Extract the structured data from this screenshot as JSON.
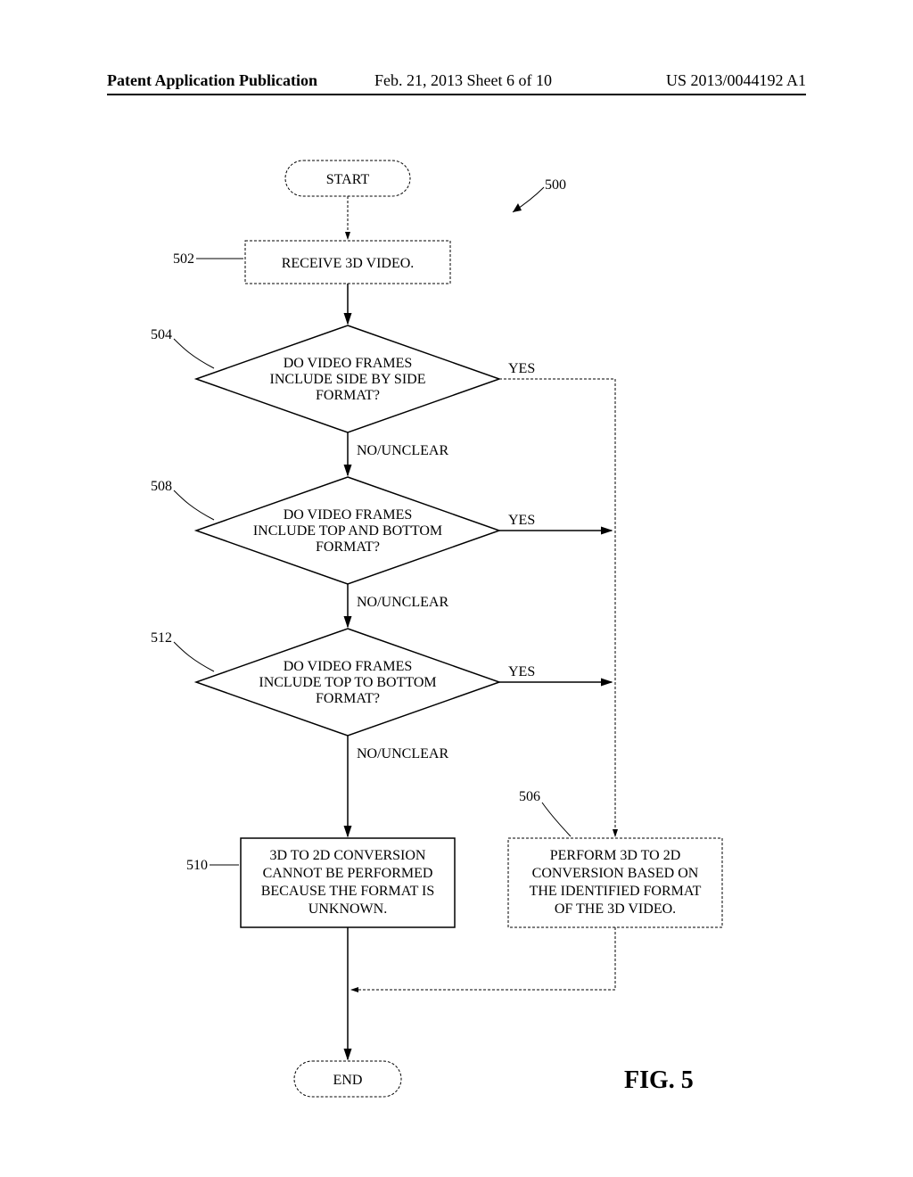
{
  "header": {
    "left": "Patent Application Publication",
    "mid": "Feb. 21, 2013  Sheet 6 of 10",
    "right": "US 2013/0044192 A1"
  },
  "flow": {
    "start": "START",
    "end": "END",
    "step502": "RECEIVE 3D VIDEO.",
    "dec504_l1": "DO VIDEO FRAMES",
    "dec504_l2": "INCLUDE SIDE BY SIDE",
    "dec504_l3": "FORMAT?",
    "dec508_l1": "DO VIDEO FRAMES",
    "dec508_l2": "INCLUDE TOP AND BOTTOM",
    "dec508_l3": "FORMAT?",
    "dec512_l1": "DO VIDEO FRAMES",
    "dec512_l2": "INCLUDE TOP TO BOTTOM",
    "dec512_l3": "FORMAT?",
    "box510_l1": "3D TO 2D CONVERSION",
    "box510_l2": "CANNOT BE PERFORMED",
    "box510_l3": "BECAUSE THE FORMAT IS",
    "box510_l4": "UNKNOWN.",
    "box506_l1": "PERFORM 3D TO 2D",
    "box506_l2": "CONVERSION BASED ON",
    "box506_l3": "THE IDENTIFIED FORMAT",
    "box506_l4": "OF THE 3D VIDEO.",
    "yes": "YES",
    "nou": "NO/UNCLEAR"
  },
  "refs": {
    "r500": "500",
    "r502": "502",
    "r504": "504",
    "r508": "508",
    "r512": "512",
    "r510": "510",
    "r506": "506"
  },
  "figure": "FIG. 5"
}
